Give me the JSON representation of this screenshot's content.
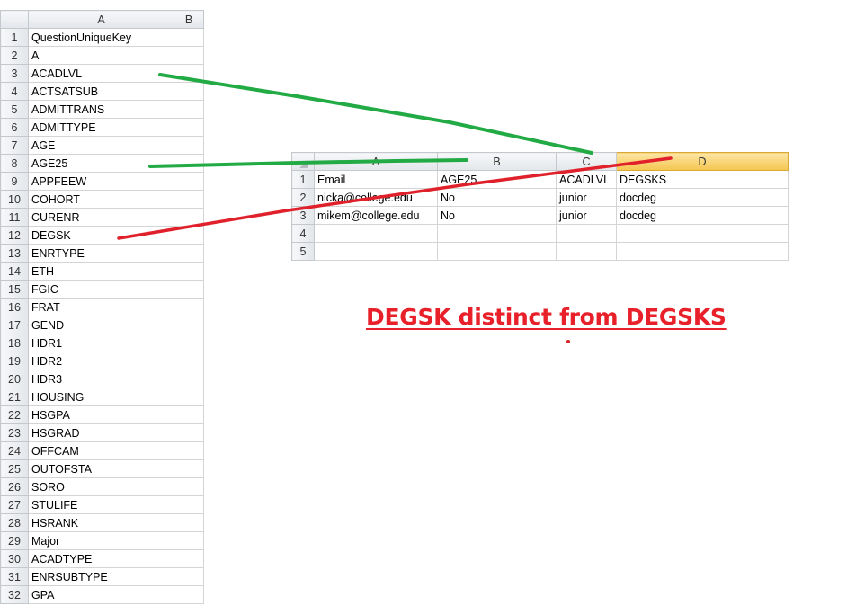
{
  "left_sheet": {
    "columns": [
      "A",
      "B"
    ],
    "rows": [
      {
        "n": "1",
        "a": "QuestionUniqueKey"
      },
      {
        "n": "2",
        "a": "A"
      },
      {
        "n": "3",
        "a": "ACADLVL"
      },
      {
        "n": "4",
        "a": "ACTSATSUB"
      },
      {
        "n": "5",
        "a": "ADMITTRANS"
      },
      {
        "n": "6",
        "a": "ADMITTYPE"
      },
      {
        "n": "7",
        "a": "AGE"
      },
      {
        "n": "8",
        "a": "AGE25"
      },
      {
        "n": "9",
        "a": "APPFEEW"
      },
      {
        "n": "10",
        "a": "COHORT"
      },
      {
        "n": "11",
        "a": "CURENR"
      },
      {
        "n": "12",
        "a": "DEGSK"
      },
      {
        "n": "13",
        "a": "ENRTYPE"
      },
      {
        "n": "14",
        "a": "ETH"
      },
      {
        "n": "15",
        "a": "FGIC"
      },
      {
        "n": "16",
        "a": "FRAT"
      },
      {
        "n": "17",
        "a": "GEND"
      },
      {
        "n": "18",
        "a": "HDR1"
      },
      {
        "n": "19",
        "a": "HDR2"
      },
      {
        "n": "20",
        "a": "HDR3"
      },
      {
        "n": "21",
        "a": "HOUSING"
      },
      {
        "n": "22",
        "a": "HSGPA"
      },
      {
        "n": "23",
        "a": "HSGRAD"
      },
      {
        "n": "24",
        "a": "OFFCAM"
      },
      {
        "n": "25",
        "a": "OUTOFSTA"
      },
      {
        "n": "26",
        "a": "SORO"
      },
      {
        "n": "27",
        "a": "STULIFE"
      },
      {
        "n": "28",
        "a": "HSRANK"
      },
      {
        "n": "29",
        "a": "Major"
      },
      {
        "n": "30",
        "a": "ACADTYPE"
      },
      {
        "n": "31",
        "a": "ENRSUBTYPE"
      },
      {
        "n": "32",
        "a": "GPA"
      }
    ]
  },
  "right_sheet": {
    "columns": [
      "A",
      "B",
      "C",
      "D"
    ],
    "rows": [
      {
        "n": "1",
        "cells": [
          "Email",
          "AGE25",
          "ACADLVL",
          "DEGSKS"
        ]
      },
      {
        "n": "2",
        "cells": [
          "nicka@college.edu",
          "No",
          "junior",
          "docdeg"
        ]
      },
      {
        "n": "3",
        "cells": [
          "mikem@college.edu",
          "No",
          "junior",
          "docdeg"
        ]
      },
      {
        "n": "4",
        "cells": [
          "",
          "",
          "",
          ""
        ]
      },
      {
        "n": "5",
        "cells": [
          "",
          "",
          "",
          ""
        ]
      }
    ]
  },
  "annotation": {
    "text": "DEGSK distinct from DEGSKS",
    "color": "#e8202a"
  },
  "colors": {
    "green_line": "#22aa44",
    "red_line": "#e0202a",
    "selected_header": "#f5c64f"
  }
}
